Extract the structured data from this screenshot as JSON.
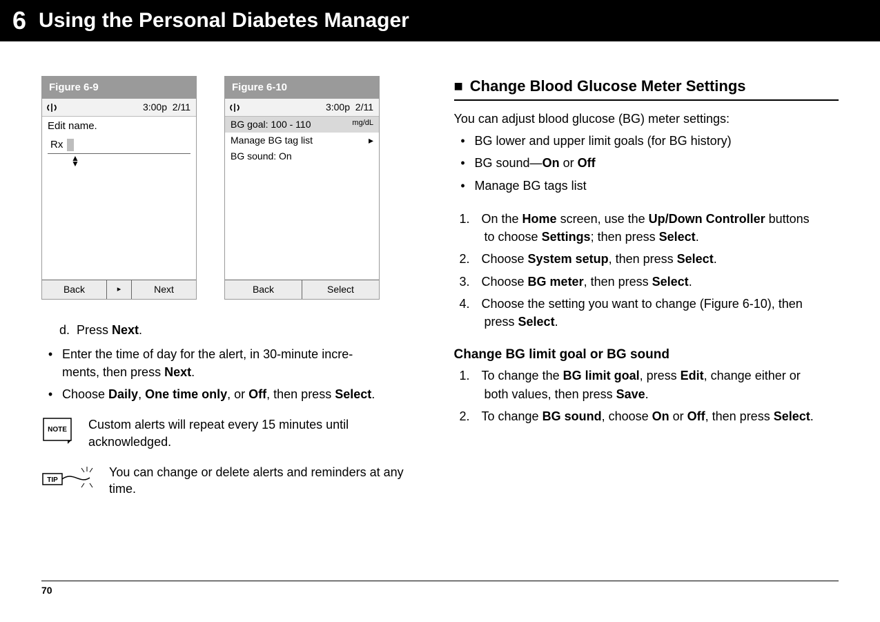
{
  "header": {
    "chapter_number": "6",
    "chapter_title": "Using the Personal Diabetes Manager"
  },
  "figures": {
    "fig_a": {
      "label": "Figure 6-9",
      "time": "3:00p",
      "date": "2/11",
      "title": "Edit name.",
      "field_value": "Rx",
      "soft_left": "Back",
      "soft_mid": "▸",
      "soft_right": "Next"
    },
    "fig_b": {
      "label": "Figure 6-10",
      "time": "3:00p",
      "date": "2/11",
      "row_goal": "BG goal: 100 - 110",
      "row_goal_unit": "mg/dL",
      "row_tags": "Manage BG tag list",
      "row_tags_arrow": "▸",
      "row_sound": "BG sound:  On",
      "soft_left": "Back",
      "soft_right": "Select"
    }
  },
  "left": {
    "step_d_letter": "d.",
    "step_d_text_pre": "Press ",
    "step_d_text_bold": "Next",
    "step_d_text_post": ".",
    "b1_pre": "Enter the time of day for the alert, in 30-minute incre-",
    "b1_line2_pre": "ments, then press ",
    "b1_line2_bold": "Next",
    "b1_line2_post": ".",
    "b2_pre": "Choose ",
    "b2_bold1": "Daily",
    "b2_mid1": ", ",
    "b2_bold2": "One time only",
    "b2_mid2": ", or ",
    "b2_bold3": "Off",
    "b2_mid3": ", then press ",
    "b2_bold4": "Select",
    "b2_post": ".",
    "note_label": "NOTE",
    "note_text": "Custom alerts will repeat every 15 minutes until acknowledged.",
    "tip_label": "TIP",
    "tip_text": "You can change or delete alerts and reminders at any time."
  },
  "right": {
    "section_marker": "■",
    "section_title": "Change Blood Glucose Meter Settings",
    "intro": "You can adjust blood glucose (BG) meter settings:",
    "bl1": "BG lower and upper limit goals (for BG history)",
    "bl2_pre": "BG sound—",
    "bl2_bold1": "On",
    "bl2_mid": " or ",
    "bl2_bold2": "Off",
    "bl3": "Manage BG tags list",
    "n1_pre": "On the ",
    "n1_b1": "Home",
    "n1_mid1": " screen, use the ",
    "n1_b2": "Up/Down Controller",
    "n1_mid2": " buttons",
    "n1_line2_pre": "to choose ",
    "n1_line2_b": "Settings",
    "n1_line2_mid": "; then press ",
    "n1_line2_b2": "Select",
    "n1_line2_post": ".",
    "n2_pre": "Choose ",
    "n2_b1": "System setup",
    "n2_mid": ", then press ",
    "n2_b2": "Select",
    "n2_post": ".",
    "n3_pre": "Choose ",
    "n3_b1": "BG meter",
    "n3_mid": ", then press ",
    "n3_b2": "Select",
    "n3_post": ".",
    "n4_pre": "Choose the setting you want to change (Figure 6-10), then",
    "n4_line2_pre": "press ",
    "n4_line2_b": "Select",
    "n4_line2_post": ".",
    "subhead": "Change BG limit goal or BG sound",
    "s1_pre": "To change the ",
    "s1_b1": "BG limit goal",
    "s1_mid1": ", press ",
    "s1_b2": "Edit",
    "s1_mid2": ", change either or",
    "s1_line2_pre": "both values, then press ",
    "s1_line2_b": "Save",
    "s1_line2_post": ".",
    "s2_pre": "To change ",
    "s2_b1": "BG sound",
    "s2_mid1": ", choose ",
    "s2_b2": "On",
    "s2_mid2": " or ",
    "s2_b3": "Off",
    "s2_mid3": ", then press ",
    "s2_b4": "Select",
    "s2_post": "."
  },
  "page_number": "70"
}
